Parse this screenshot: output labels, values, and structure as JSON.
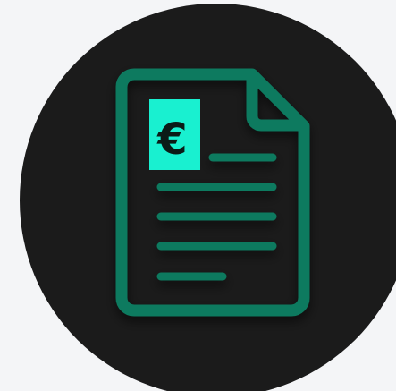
{
  "icon": {
    "name": "invoice-document-icon",
    "currency_symbol": "€"
  },
  "colors": {
    "background": "#f4f5f7",
    "disc": "#1b1b1b",
    "document_stroke": "#0b7a5f",
    "badge_fill": "#19f0d0",
    "badge_text": "#0b1b17"
  }
}
